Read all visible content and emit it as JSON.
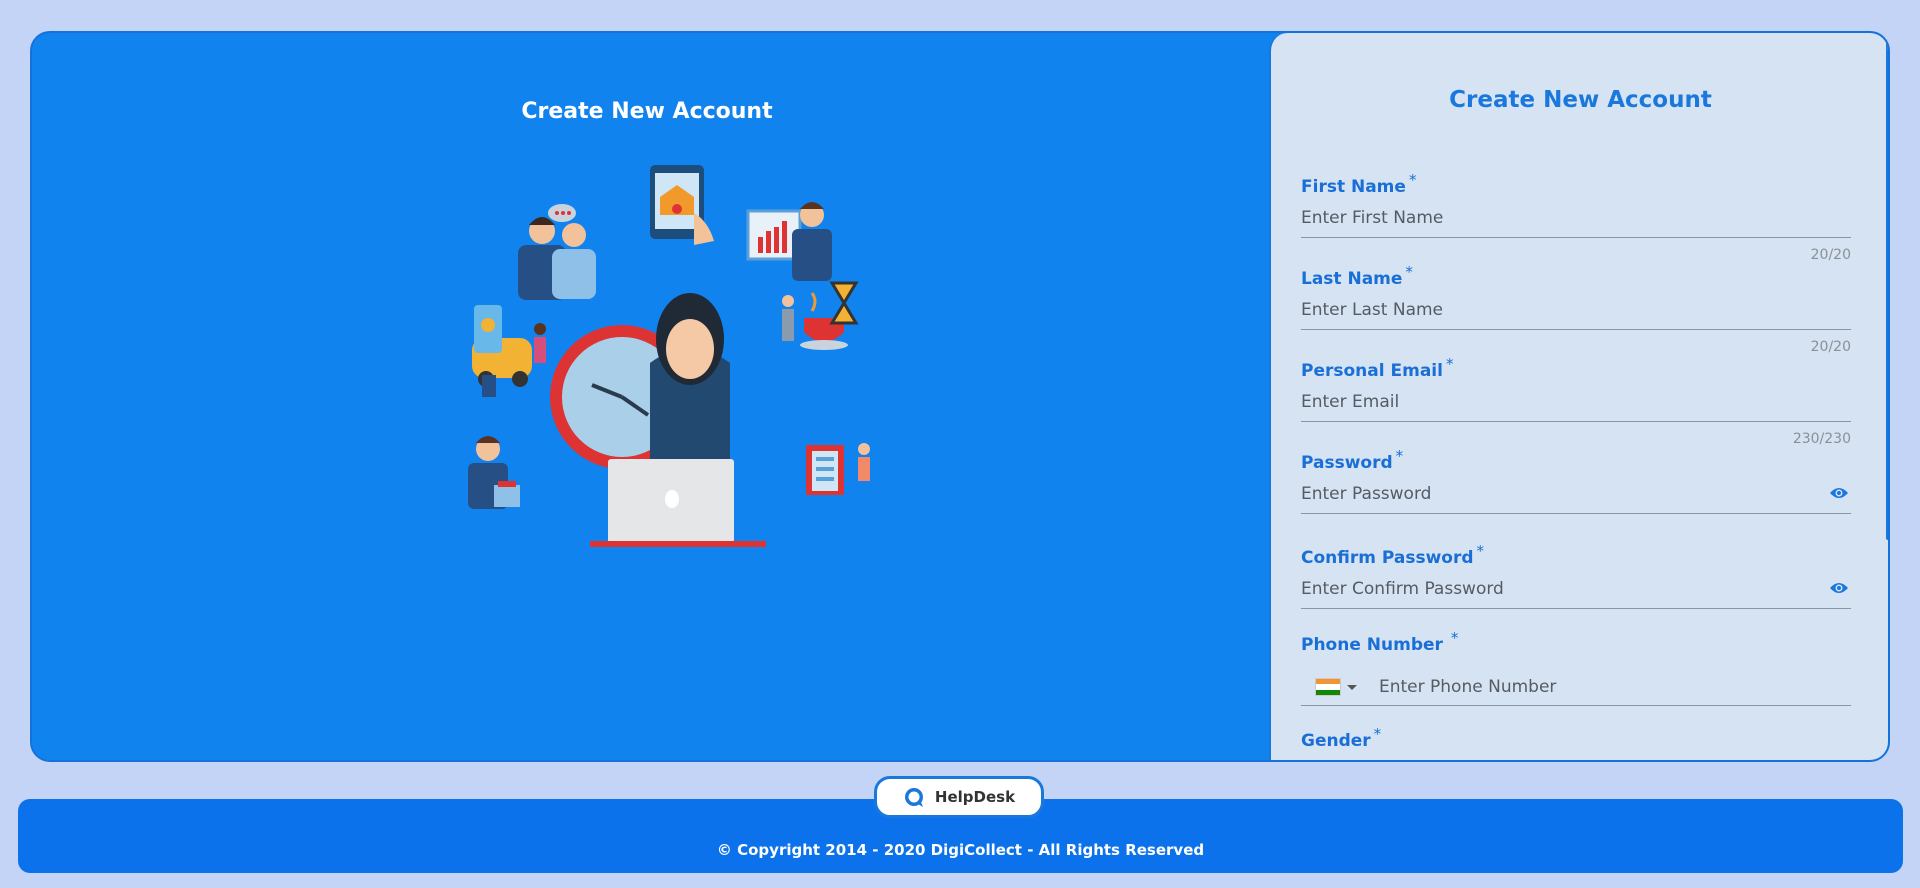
{
  "left": {
    "title": "Create New Account"
  },
  "form": {
    "title": "Create New Account",
    "fields": [
      {
        "label": "First Name",
        "required": "*",
        "placeholder": "Enter First Name",
        "counter": "20/20"
      },
      {
        "label": "Last Name",
        "required": "*",
        "placeholder": "Enter Last Name",
        "counter": "20/20"
      },
      {
        "label": "Personal Email",
        "required": "*",
        "placeholder": "Enter Email",
        "counter": "230/230"
      },
      {
        "label": "Password",
        "required": "*",
        "placeholder": "Enter Password",
        "icon": "eye-icon"
      },
      {
        "label": "Confirm Password",
        "required": "*",
        "placeholder": "Enter Confirm Password",
        "icon": "eye-icon"
      },
      {
        "label": "Phone Number",
        "required": "*",
        "placeholder": "Enter Phone Number",
        "country_icon": "india-flag-icon"
      },
      {
        "label": "Gender",
        "required": "*"
      }
    ]
  },
  "helpdesk": {
    "label": "HelpDesk",
    "icon": "chat-bubble-icon"
  },
  "footer": {
    "copyright": "© Copyright 2014 - 2020 DigiCollect - All Rights Reserved"
  },
  "colors": {
    "primary": "#1183ef",
    "background": "#c3d4f7",
    "panel": "#d6e3f2",
    "accent": "#1a78dd"
  }
}
